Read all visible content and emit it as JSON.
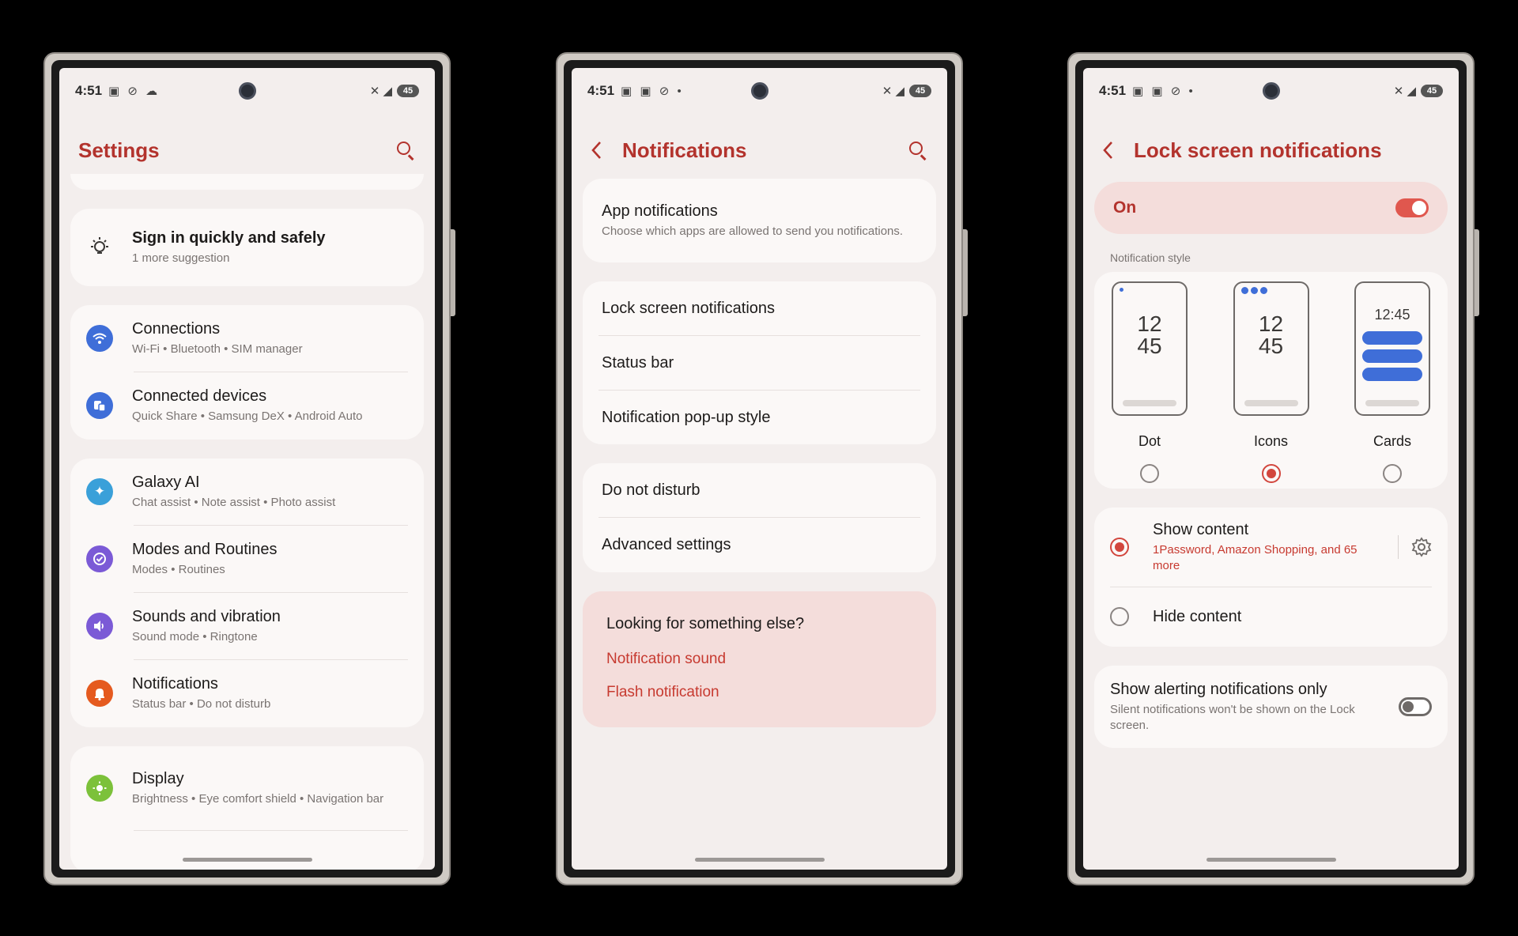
{
  "status": {
    "time": "4:51",
    "left_icons_1": "▣ ⊘ ☁",
    "left_icons_2": "▣ ▣ ⊘ •",
    "right_icons": "✕ ◢",
    "battery": "45"
  },
  "screen1": {
    "title": "Settings",
    "suggestion": {
      "title": "Sign in quickly and safely",
      "subtitle": "1 more suggestion"
    },
    "groups": [
      [
        {
          "title": "Connections",
          "subtitle": "Wi-Fi  •  Bluetooth  •  SIM manager",
          "icon": "wifi-icon",
          "color": "#3f6ed8"
        },
        {
          "title": "Connected devices",
          "subtitle": "Quick Share  •  Samsung DeX  •  Android Auto",
          "icon": "devices-icon",
          "color": "#3f6ed8"
        }
      ],
      [
        {
          "title": "Galaxy AI",
          "subtitle": "Chat assist  •  Note assist  •  Photo assist",
          "icon": "sparkle-icon",
          "color": "#3aa0d9"
        },
        {
          "title": "Modes and Routines",
          "subtitle": "Modes  •  Routines",
          "icon": "check-circle-icon",
          "color": "#7b5ad6"
        },
        {
          "title": "Sounds and vibration",
          "subtitle": "Sound mode  •  Ringtone",
          "icon": "speaker-icon",
          "color": "#7b5ad6"
        },
        {
          "title": "Notifications",
          "subtitle": "Status bar  •  Do not disturb",
          "icon": "bell-icon",
          "color": "#e55a1f"
        }
      ],
      [
        {
          "title": "Display",
          "subtitle": "Brightness  •  Eye comfort shield  •  Navigation bar",
          "icon": "sun-icon",
          "color": "#7cc13a"
        }
      ]
    ]
  },
  "screen2": {
    "title": "Notifications",
    "app_notifications": {
      "title": "App notifications",
      "subtitle": "Choose which apps are allowed to send you notifications."
    },
    "group2": [
      "Lock screen notifications",
      "Status bar",
      "Notification pop-up style"
    ],
    "group3": [
      "Do not disturb",
      "Advanced settings"
    ],
    "suggest": {
      "title": "Looking for something else?",
      "links": [
        "Notification sound",
        "Flash notification"
      ]
    }
  },
  "screen3": {
    "title": "Lock screen notifications",
    "master_label": "On",
    "section_label": "Notification style",
    "styles": [
      {
        "label": "Dot",
        "clock_h": "12",
        "clock_m": "45",
        "selected": false
      },
      {
        "label": "Icons",
        "clock_h": "12",
        "clock_m": "45",
        "selected": true
      },
      {
        "label": "Cards",
        "clock": "12:45",
        "selected": false
      }
    ],
    "show_content": {
      "title": "Show content",
      "subtitle": "1Password, Amazon Shopping, and 65 more"
    },
    "hide_content": {
      "title": "Hide content"
    },
    "alerting": {
      "title": "Show alerting notifications only",
      "subtitle": "Silent notifications won't be shown on the Lock screen."
    }
  },
  "colors": {
    "accent": "#b3332d",
    "link": "#c73a30",
    "switch_on": "#e0574e",
    "blue": "#3f6ed8"
  }
}
